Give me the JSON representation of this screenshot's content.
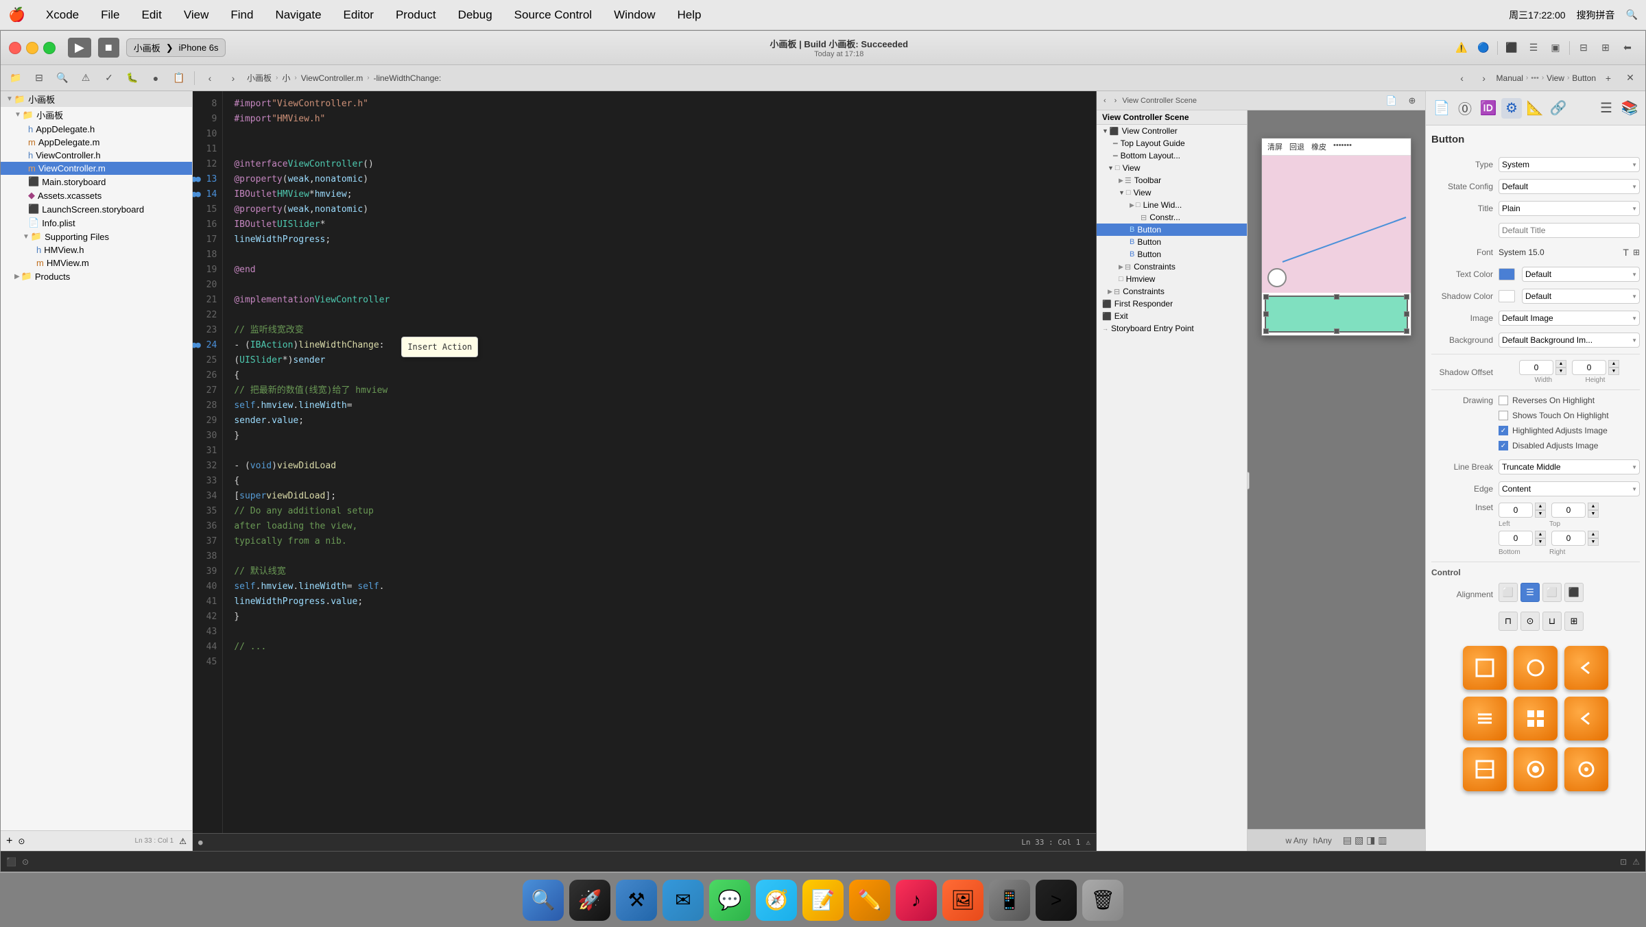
{
  "menubar": {
    "apple": "🍎",
    "items": [
      "Xcode",
      "File",
      "Edit",
      "View",
      "Find",
      "Navigate",
      "Editor",
      "Product",
      "Debug",
      "Source Control",
      "Window",
      "Help"
    ],
    "time": "周三17:22:00",
    "input_method": "搜狗拼音"
  },
  "titlebar": {
    "scheme": "小画板",
    "device": "iPhone 6s",
    "build_title": "小画板 | Build 小画板: Succeeded",
    "build_time": "Today at 17:18"
  },
  "breadcrumb_left": {
    "items": [
      "小画板",
      "小",
      "ViewController.m",
      "-lineWidthChange:"
    ]
  },
  "breadcrumb_right": {
    "items": [
      "Manual",
      "View",
      "Button"
    ]
  },
  "file_tree": {
    "root": "小画板",
    "items": [
      {
        "name": "小画板",
        "type": "folder",
        "level": 1,
        "expanded": true
      },
      {
        "name": "AppDelegate.h",
        "type": "h",
        "level": 2
      },
      {
        "name": "AppDelegate.m",
        "type": "m",
        "level": 2
      },
      {
        "name": "ViewController.h",
        "type": "h",
        "level": 2
      },
      {
        "name": "ViewController.m",
        "type": "m",
        "level": 2,
        "selected": true
      },
      {
        "name": "Main.storyboard",
        "type": "storyboard",
        "level": 2
      },
      {
        "name": "Assets.xcassets",
        "type": "xcassets",
        "level": 2
      },
      {
        "name": "LaunchScreen.storyboard",
        "type": "storyboard",
        "level": 2
      },
      {
        "name": "Info.plist",
        "type": "plist",
        "level": 2
      },
      {
        "name": "Supporting Files",
        "type": "folder",
        "level": 2,
        "expanded": true
      },
      {
        "name": "HMView.h",
        "type": "h",
        "level": 3
      },
      {
        "name": "HMView.m",
        "type": "m",
        "level": 3
      },
      {
        "name": "Products",
        "type": "folder",
        "level": 1
      }
    ]
  },
  "code_editor": {
    "filename": "ViewController.m",
    "lines": [
      {
        "num": 8,
        "content": "#import \"ViewController.h\""
      },
      {
        "num": 9,
        "content": "#import \"HMView.h\""
      },
      {
        "num": 10,
        "content": ""
      },
      {
        "num": 11,
        "content": ""
      },
      {
        "num": 12,
        "content": "@interface ViewController ()"
      },
      {
        "num": 13,
        "content": "@property (weak, nonatomic)",
        "breakpoint": true
      },
      {
        "num": 14,
        "content": "    IBOutlet HMView* hmview;",
        "breakpoint": true
      },
      {
        "num": 15,
        "content": "@property (weak, nonatomic)"
      },
      {
        "num": 16,
        "content": "    IBOutlet UISlider*"
      },
      {
        "num": 17,
        "content": "    lineWidthProgress;"
      },
      {
        "num": 18,
        "content": ""
      },
      {
        "num": 19,
        "content": "@end"
      },
      {
        "num": 20,
        "content": ""
      },
      {
        "num": 21,
        "content": "@implementation ViewController"
      },
      {
        "num": 22,
        "content": ""
      },
      {
        "num": 23,
        "content": "// 监听线宽改变"
      },
      {
        "num": 24,
        "content": "- (IBAction)lineWidthChange:",
        "breakpoint": true
      },
      {
        "num": 25,
        "content": "    (UISlider*)sender"
      },
      {
        "num": 26,
        "content": "{"
      },
      {
        "num": 27,
        "content": "    // 把最新的数值(线宽)给了 hmview"
      },
      {
        "num": 28,
        "content": "    self.hmview.lineWidth ="
      },
      {
        "num": 29,
        "content": "        sender.value;"
      },
      {
        "num": 30,
        "content": "}"
      },
      {
        "num": 31,
        "content": ""
      },
      {
        "num": 32,
        "content": "- (void)viewDidLoad"
      },
      {
        "num": 33,
        "content": "{"
      },
      {
        "num": 34,
        "content": "    [super viewDidLoad];"
      },
      {
        "num": 35,
        "content": "    // Do any additional setup"
      },
      {
        "num": 36,
        "content": "         after loading the view,"
      },
      {
        "num": 37,
        "content": "         typically from a nib."
      },
      {
        "num": 38,
        "content": ""
      },
      {
        "num": 39,
        "content": "    // 默认线宽"
      },
      {
        "num": 40,
        "content": "    self.hmview.lineWidth = self."
      },
      {
        "num": 41,
        "content": "        lineWidthProgress.value;"
      },
      {
        "num": 42,
        "content": "}"
      },
      {
        "num": 43,
        "content": ""
      },
      {
        "num": 44,
        "content": "    // ..."
      }
    ]
  },
  "scene_tree": {
    "title": "View Controller Scene",
    "items": [
      {
        "name": "View Controller",
        "level": 0,
        "type": "vc",
        "expanded": true
      },
      {
        "name": "Top Layout Guide",
        "level": 1,
        "type": "guide"
      },
      {
        "name": "Bottom Layout...",
        "level": 1,
        "type": "guide"
      },
      {
        "name": "View",
        "level": 1,
        "type": "view",
        "expanded": true
      },
      {
        "name": "Toolbar",
        "level": 2,
        "type": "toolbar"
      },
      {
        "name": "View",
        "level": 2,
        "type": "view",
        "expanded": true
      },
      {
        "name": "Line Wid...",
        "level": 3,
        "type": "view"
      },
      {
        "name": "Constr...",
        "level": 4,
        "type": "constraint"
      },
      {
        "name": "Button",
        "level": 3,
        "type": "button",
        "selected": true
      },
      {
        "name": "Button",
        "level": 3,
        "type": "button"
      },
      {
        "name": "Button",
        "level": 3,
        "type": "button"
      },
      {
        "name": "Constraints",
        "level": 2,
        "type": "constraints"
      },
      {
        "name": "Hmview",
        "level": 2,
        "type": "view"
      },
      {
        "name": "Constraints",
        "level": 1,
        "type": "constraints"
      },
      {
        "name": "First Responder",
        "level": 0,
        "type": "responder"
      },
      {
        "name": "Exit",
        "level": 0,
        "type": "exit"
      },
      {
        "name": "Storyboard Entry Point",
        "level": 0,
        "type": "entry"
      }
    ]
  },
  "inspector": {
    "title": "Button",
    "type_label": "Type",
    "type_value": "System",
    "state_label": "State Config",
    "state_value": "Default",
    "title_label": "Title",
    "title_value": "Plain",
    "default_title_placeholder": "Default Title",
    "font_label": "Font",
    "font_value": "System 15.0",
    "text_color_label": "Text Color",
    "text_color_value": "Default",
    "shadow_color_label": "Shadow Color",
    "shadow_color_value": "Default",
    "image_label": "Image",
    "image_placeholder": "Default Image",
    "background_label": "Background",
    "background_placeholder": "Default Background Im...",
    "shadow_offset_label": "Shadow Offset",
    "width_label": "Width",
    "height_label": "Height",
    "shadow_w": "0",
    "shadow_h": "0",
    "drawing_label": "Drawing",
    "reverses_label": "Reverses On Highlight",
    "shows_touch_label": "Shows Touch On Highlight",
    "highlighted_label": "Highlighted Adjusts Image",
    "disabled_label": "Disabled Adjusts Image",
    "line_break_label": "Line Break",
    "line_break_value": "Truncate Middle",
    "edge_label": "Edge",
    "edge_value": "Content",
    "inset_label": "Inset",
    "left_label": "Left",
    "top_label": "Top",
    "left_val": "0",
    "top_val": "0",
    "bottom_val": "0",
    "right_val": "0",
    "bottom_label": "Bottom",
    "right_label": "Right",
    "control_title": "Control",
    "alignment_label": "Alignment"
  },
  "preview": {
    "toolbar_items": [
      "清屏",
      "回退",
      "橡皮"
    ],
    "dots": "•••••••"
  },
  "tooltip": {
    "text": "Insert Action"
  },
  "bottom_status": {
    "left": "●",
    "line_col": "Ln 33 : Col 1"
  },
  "orange_buttons": {
    "icons": [
      "⬛",
      "⭕",
      "◀",
      "≡",
      "⊞",
      "◀",
      "⬛",
      "⭕",
      "⊙"
    ]
  }
}
